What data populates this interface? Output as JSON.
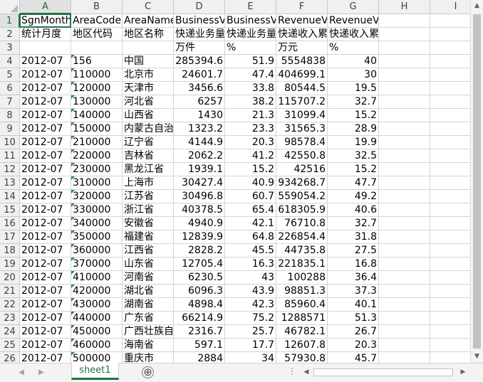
{
  "columns": [
    "A",
    "B",
    "C",
    "D",
    "E",
    "F",
    "G",
    "H",
    "I"
  ],
  "rows": [
    [
      "SgnMonth",
      "AreaCode",
      "AreaName",
      "BusinessVolume",
      "BusinessVolumeGrowth",
      "RevenueVolume",
      "RevenueVolumeGrowth",
      "",
      ""
    ],
    [
      "统计月度",
      "地区代码",
      "地区名称",
      "快递业务量",
      "快递业务量",
      "快递收入累计值",
      "快递收入累计值同比增长",
      "",
      ""
    ],
    [
      "",
      "",
      "",
      "万件",
      "%",
      "万元",
      "%",
      "",
      ""
    ],
    [
      "2012-07",
      "156",
      "中国",
      "285394.6",
      "51.9",
      "5554838",
      "40",
      "",
      ""
    ],
    [
      "2012-07",
      "110000",
      "北京市",
      "24601.7",
      "47.4",
      "404699.1",
      "30",
      "",
      ""
    ],
    [
      "2012-07",
      "120000",
      "天津市",
      "3456.6",
      "33.8",
      "80544.5",
      "19.5",
      "",
      ""
    ],
    [
      "2012-07",
      "130000",
      "河北省",
      "6257",
      "38.2",
      "115707.2",
      "32.7",
      "",
      ""
    ],
    [
      "2012-07",
      "140000",
      "山西省",
      "1430",
      "21.3",
      "31099.4",
      "15.2",
      "",
      ""
    ],
    [
      "2012-07",
      "150000",
      "内蒙古自治区",
      "1323.2",
      "23.3",
      "31565.3",
      "28.9",
      "",
      ""
    ],
    [
      "2012-07",
      "210000",
      "辽宁省",
      "4144.9",
      "20.3",
      "98578.4",
      "19.9",
      "",
      ""
    ],
    [
      "2012-07",
      "220000",
      "吉林省",
      "2062.2",
      "41.2",
      "42550.8",
      "32.5",
      "",
      ""
    ],
    [
      "2012-07",
      "230000",
      "黑龙江省",
      "1939.1",
      "15.2",
      "42516",
      "15.2",
      "",
      ""
    ],
    [
      "2012-07",
      "310000",
      "上海市",
      "30427.4",
      "40.9",
      "934268.7",
      "47.7",
      "",
      ""
    ],
    [
      "2012-07",
      "320000",
      "江苏省",
      "30496.8",
      "60.7",
      "559054.2",
      "49.2",
      "",
      ""
    ],
    [
      "2012-07",
      "330000",
      "浙江省",
      "40378.5",
      "65.4",
      "618305.9",
      "40.6",
      "",
      ""
    ],
    [
      "2012-07",
      "340000",
      "安徽省",
      "4940.9",
      "42.1",
      "76710.8",
      "32.7",
      "",
      ""
    ],
    [
      "2012-07",
      "350000",
      "福建省",
      "12839.9",
      "64.8",
      "226854.4",
      "31.8",
      "",
      ""
    ],
    [
      "2012-07",
      "360000",
      "江西省",
      "2828.2",
      "45.5",
      "44735.8",
      "27.5",
      "",
      ""
    ],
    [
      "2012-07",
      "370000",
      "山东省",
      "12705.4",
      "16.3",
      "221835.1",
      "16.8",
      "",
      ""
    ],
    [
      "2012-07",
      "410000",
      "河南省",
      "6230.5",
      "43",
      "100288",
      "36.4",
      "",
      ""
    ],
    [
      "2012-07",
      "420000",
      "湖北省",
      "6096.3",
      "43.9",
      "98851.3",
      "37.3",
      "",
      ""
    ],
    [
      "2012-07",
      "430000",
      "湖南省",
      "4898.4",
      "42.3",
      "85960.4",
      "40.1",
      "",
      ""
    ],
    [
      "2012-07",
      "440000",
      "广东省",
      "66214.9",
      "75.2",
      "1288571",
      "51.3",
      "",
      ""
    ],
    [
      "2012-07",
      "450000",
      "广西壮族自治区",
      "2316.7",
      "25.7",
      "46782.1",
      "26.7",
      "",
      ""
    ],
    [
      "2012-07",
      "460000",
      "海南省",
      "597.1",
      "17.7",
      "12607.8",
      "20.3",
      "",
      ""
    ],
    [
      "2012-07",
      "500000",
      "重庆市",
      "2884",
      "34",
      "57930.8",
      "45.7",
      "",
      ""
    ]
  ],
  "sheet_tab": "sheet1",
  "add_sheet_label": "⊕",
  "more_label": "⋮",
  "colors": {
    "accent": "#217346",
    "marker": "#2e8b3c",
    "grid": "#d4d4d4"
  }
}
